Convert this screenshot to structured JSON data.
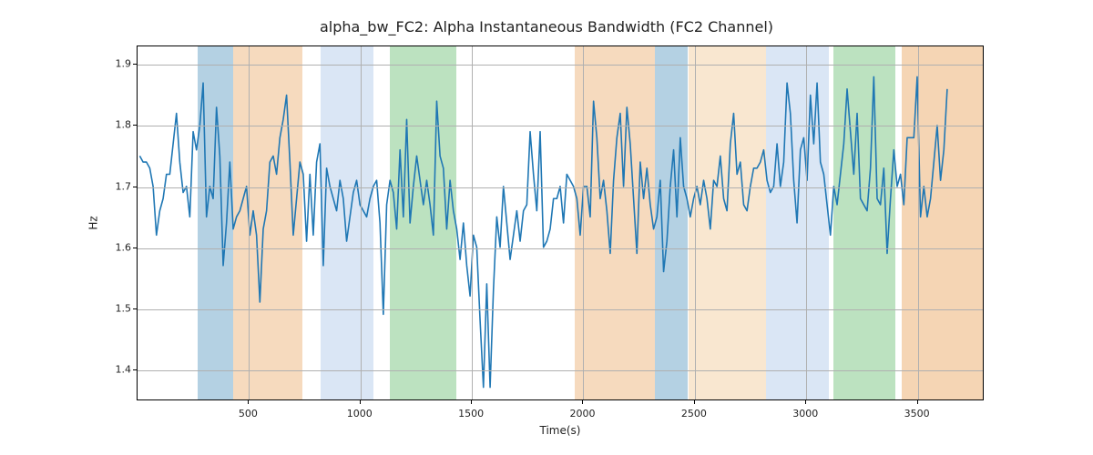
{
  "chart_data": {
    "type": "line",
    "title": "alpha_bw_FC2: Alpha Instantaneous Bandwidth (FC2 Channel)",
    "xlabel": "Time(s)",
    "ylabel": "Hz",
    "xlim": [
      0,
      3800
    ],
    "ylim": [
      1.35,
      1.93
    ],
    "xticks": [
      500,
      1000,
      1500,
      2000,
      2500,
      3000,
      3500
    ],
    "yticks": [
      1.4,
      1.5,
      1.6,
      1.7,
      1.8,
      1.9
    ],
    "line_color": "#1f77b4",
    "spans": [
      {
        "x0": 270,
        "x1": 430,
        "fill": "#6aa3c8",
        "alpha": 0.5
      },
      {
        "x0": 430,
        "x1": 740,
        "fill": "#e69544",
        "alpha": 0.35
      },
      {
        "x0": 820,
        "x1": 1060,
        "fill": "#aec7e8",
        "alpha": 0.45
      },
      {
        "x0": 1130,
        "x1": 1430,
        "fill": "#6bbf73",
        "alpha": 0.45
      },
      {
        "x0": 1960,
        "x1": 2320,
        "fill": "#e69544",
        "alpha": 0.35
      },
      {
        "x0": 2320,
        "x1": 2470,
        "fill": "#6aa3c8",
        "alpha": 0.5
      },
      {
        "x0": 2470,
        "x1": 2820,
        "fill": "#f0c28a",
        "alpha": 0.4
      },
      {
        "x0": 2820,
        "x1": 3100,
        "fill": "#aec7e8",
        "alpha": 0.45
      },
      {
        "x0": 3120,
        "x1": 3400,
        "fill": "#6bbf73",
        "alpha": 0.45
      },
      {
        "x0": 3430,
        "x1": 3800,
        "fill": "#e69544",
        "alpha": 0.4
      }
    ],
    "x": [
      10,
      25,
      40,
      55,
      70,
      85,
      100,
      115,
      130,
      145,
      160,
      175,
      190,
      205,
      220,
      235,
      250,
      265,
      280,
      295,
      310,
      325,
      340,
      355,
      370,
      385,
      400,
      415,
      430,
      445,
      460,
      475,
      490,
      505,
      520,
      535,
      550,
      565,
      580,
      595,
      610,
      625,
      640,
      655,
      670,
      685,
      700,
      715,
      730,
      745,
      760,
      775,
      790,
      805,
      820,
      835,
      850,
      865,
      880,
      895,
      910,
      925,
      940,
      955,
      970,
      985,
      1000,
      1015,
      1030,
      1045,
      1060,
      1075,
      1090,
      1105,
      1120,
      1135,
      1150,
      1165,
      1180,
      1195,
      1210,
      1225,
      1240,
      1255,
      1270,
      1285,
      1300,
      1315,
      1330,
      1345,
      1360,
      1375,
      1390,
      1405,
      1420,
      1435,
      1450,
      1465,
      1480,
      1495,
      1510,
      1525,
      1540,
      1555,
      1570,
      1585,
      1600,
      1615,
      1630,
      1645,
      1660,
      1675,
      1690,
      1705,
      1720,
      1735,
      1750,
      1765,
      1780,
      1795,
      1810,
      1825,
      1840,
      1855,
      1870,
      1885,
      1900,
      1915,
      1930,
      1945,
      1960,
      1975,
      1990,
      2005,
      2020,
      2035,
      2050,
      2065,
      2080,
      2095,
      2110,
      2125,
      2140,
      2155,
      2170,
      2185,
      2200,
      2215,
      2230,
      2245,
      2260,
      2275,
      2290,
      2305,
      2320,
      2335,
      2350,
      2365,
      2380,
      2395,
      2410,
      2425,
      2440,
      2455,
      2470,
      2485,
      2500,
      2515,
      2530,
      2545,
      2560,
      2575,
      2590,
      2605,
      2620,
      2635,
      2650,
      2665,
      2680,
      2695,
      2710,
      2725,
      2740,
      2755,
      2770,
      2785,
      2800,
      2815,
      2830,
      2845,
      2860,
      2875,
      2890,
      2905,
      2920,
      2935,
      2950,
      2965,
      2980,
      2995,
      3010,
      3025,
      3040,
      3055,
      3070,
      3085,
      3100,
      3115,
      3130,
      3145,
      3160,
      3175,
      3190,
      3205,
      3220,
      3235,
      3250,
      3265,
      3280,
      3295,
      3310,
      3325,
      3340,
      3355,
      3370,
      3385,
      3400,
      3415,
      3430,
      3445,
      3460,
      3475,
      3490,
      3505,
      3520,
      3535,
      3550,
      3565,
      3580,
      3595,
      3610,
      3625,
      3640,
      3655,
      3670,
      3685,
      3700,
      3715,
      3730,
      3745,
      3760,
      3775,
      3790
    ],
    "values": [
      1.75,
      1.74,
      1.74,
      1.73,
      1.7,
      1.62,
      1.66,
      1.68,
      1.72,
      1.72,
      1.77,
      1.82,
      1.74,
      1.69,
      1.7,
      1.65,
      1.79,
      1.76,
      1.8,
      1.87,
      1.65,
      1.7,
      1.68,
      1.83,
      1.75,
      1.57,
      1.64,
      1.74,
      1.63,
      1.65,
      1.66,
      1.68,
      1.7,
      1.62,
      1.66,
      1.62,
      1.51,
      1.63,
      1.66,
      1.74,
      1.75,
      1.72,
      1.78,
      1.81,
      1.85,
      1.74,
      1.62,
      1.68,
      1.74,
      1.72,
      1.61,
      1.72,
      1.62,
      1.74,
      1.77,
      1.57,
      1.73,
      1.7,
      1.68,
      1.66,
      1.71,
      1.68,
      1.61,
      1.65,
      1.69,
      1.71,
      1.67,
      1.66,
      1.65,
      1.68,
      1.7,
      1.71,
      1.64,
      1.49,
      1.67,
      1.71,
      1.69,
      1.63,
      1.76,
      1.65,
      1.81,
      1.64,
      1.7,
      1.75,
      1.71,
      1.67,
      1.71,
      1.67,
      1.62,
      1.84,
      1.75,
      1.73,
      1.63,
      1.71,
      1.66,
      1.63,
      1.58,
      1.64,
      1.57,
      1.52,
      1.62,
      1.6,
      1.48,
      1.37,
      1.54,
      1.37,
      1.53,
      1.65,
      1.6,
      1.7,
      1.64,
      1.58,
      1.62,
      1.66,
      1.61,
      1.66,
      1.67,
      1.79,
      1.72,
      1.66,
      1.79,
      1.6,
      1.61,
      1.63,
      1.68,
      1.68,
      1.7,
      1.64,
      1.72,
      1.71,
      1.7,
      1.68,
      1.62,
      1.7,
      1.7,
      1.65,
      1.84,
      1.78,
      1.68,
      1.71,
      1.66,
      1.59,
      1.71,
      1.78,
      1.82,
      1.7,
      1.83,
      1.77,
      1.68,
      1.59,
      1.74,
      1.68,
      1.73,
      1.67,
      1.63,
      1.65,
      1.71,
      1.56,
      1.61,
      1.7,
      1.76,
      1.65,
      1.78,
      1.7,
      1.68,
      1.65,
      1.68,
      1.7,
      1.67,
      1.71,
      1.68,
      1.63,
      1.71,
      1.7,
      1.75,
      1.68,
      1.66,
      1.77,
      1.82,
      1.72,
      1.74,
      1.67,
      1.66,
      1.7,
      1.73,
      1.73,
      1.74,
      1.76,
      1.71,
      1.69,
      1.7,
      1.77,
      1.7,
      1.74,
      1.87,
      1.82,
      1.71,
      1.64,
      1.76,
      1.78,
      1.71,
      1.85,
      1.77,
      1.87,
      1.74,
      1.72,
      1.67,
      1.62,
      1.7,
      1.67,
      1.72,
      1.77,
      1.86,
      1.79,
      1.72,
      1.82,
      1.68,
      1.67,
      1.66,
      1.73,
      1.88,
      1.68,
      1.67,
      1.73,
      1.59,
      1.68,
      1.76,
      1.7,
      1.72,
      1.67,
      1.78,
      1.78,
      1.78,
      1.88,
      1.65,
      1.7,
      1.65,
      1.68,
      1.74,
      1.8,
      1.71,
      1.76,
      1.86
    ]
  }
}
